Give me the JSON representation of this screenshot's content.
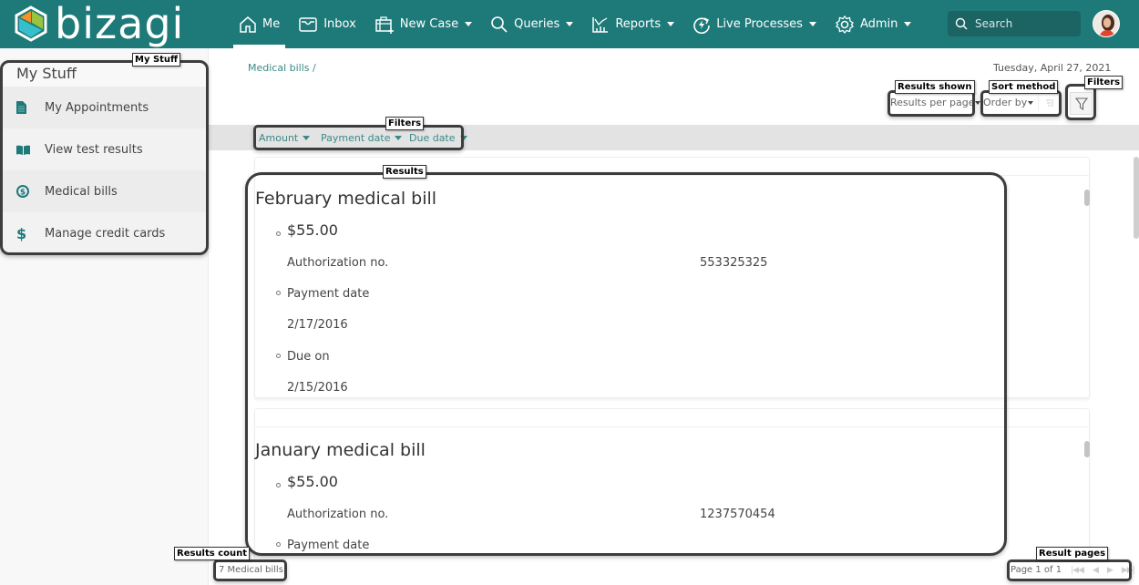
{
  "app": {
    "brand": "bizagi"
  },
  "nav": {
    "items": [
      {
        "label": "Me",
        "icon": "home-icon",
        "active": true,
        "dropdown": false
      },
      {
        "label": "Inbox",
        "icon": "inbox-icon",
        "active": false,
        "dropdown": false
      },
      {
        "label": "New Case",
        "icon": "new-case-icon",
        "active": false,
        "dropdown": true
      },
      {
        "label": "Queries",
        "icon": "search-icon",
        "active": false,
        "dropdown": true
      },
      {
        "label": "Reports",
        "icon": "reports-icon",
        "active": false,
        "dropdown": true
      },
      {
        "label": "Live Processes",
        "icon": "live-processes-icon",
        "active": false,
        "dropdown": true
      },
      {
        "label": "Admin",
        "icon": "gear-icon",
        "active": false,
        "dropdown": true
      }
    ],
    "search_placeholder": "Search"
  },
  "sidebar": {
    "title": "My Stuff",
    "items": [
      {
        "label": "My Appointments",
        "icon": "document-icon"
      },
      {
        "label": "View test results",
        "icon": "book-icon"
      },
      {
        "label": "Medical bills",
        "icon": "dollar-circle-icon"
      },
      {
        "label": "Manage credit cards",
        "icon": "dollar-icon"
      }
    ]
  },
  "main": {
    "breadcrumb": "Medical bills /",
    "date": "Tuesday, April 27, 2021",
    "results_per_page": "Results per page",
    "order_by": "Order by",
    "filters": [
      "Amount",
      "Payment date",
      "Due date"
    ],
    "results": [
      {
        "title": "February medical bill",
        "amount": "$55.00",
        "auth_label": "Authorization no.",
        "auth_value": "553325325",
        "payment_label": "Payment date",
        "payment_value": "2/17/2016",
        "due_label": "Due on",
        "due_value": "2/15/2016"
      },
      {
        "title": "January medical bill",
        "amount": "$55.00",
        "auth_label": "Authorization no.",
        "auth_value": "1237570454",
        "payment_label": "Payment date"
      }
    ],
    "results_count": "7 Medical bills",
    "pagination": "Page 1 of 1"
  },
  "annotations": {
    "my_stuff": "My Stuff",
    "filters_bar": "Filters",
    "results_shown": "Results shown",
    "sort_method": "Sort method",
    "filters_button": "Filters",
    "results": "Results",
    "results_count": "Results count",
    "result_pages": "Result pages"
  },
  "colors": {
    "brand_teal": "#1e7a79",
    "link_teal": "#3a8a88"
  }
}
